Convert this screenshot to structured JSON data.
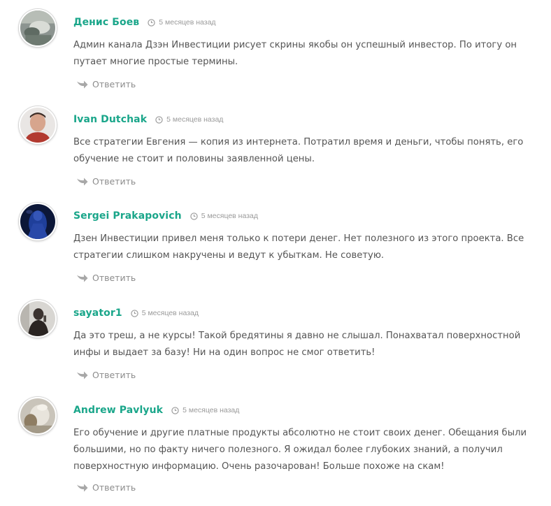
{
  "comments": [
    {
      "author": "Денис Боев",
      "time": "5 месяцев назад",
      "text": "Админ канала Дзэн Инвестиции рисует скрины якобы он успешный инвестор. По итогу он путает многие простые термины.",
      "reply_label": "Ответить",
      "avatar_icon": "user-photo-avatar"
    },
    {
      "author": "Ivan Dutchak",
      "time": "5 месяцев назад",
      "text": "Все стратегии Евгения — копия из интернета. Потратил время и деньги, чтобы понять, его обучение не стоит и половины заявленной цены.",
      "reply_label": "Ответить",
      "avatar_icon": "user-photo-avatar"
    },
    {
      "author": "Sergei Prakapovich",
      "time": "5 месяцев назад",
      "text": "Дзен Инвестиции привел меня только к потери денег. Нет полезного из этого проекта. Все стратегии слишком накручены и ведут к убыткам. Не советую.",
      "reply_label": "Ответить",
      "avatar_icon": "user-photo-avatar"
    },
    {
      "author": "sayator1",
      "time": "5 месяцев назад",
      "text": "Да это треш, а не курсы! Такой бредятины я давно не слышал. Понахватал поверхностной инфы и выдает за базу! Ни на один вопрос не смог ответить!",
      "reply_label": "Ответить",
      "avatar_icon": "user-photo-avatar"
    },
    {
      "author": "Andrew Pavlyuk",
      "time": "5 месяцев назад",
      "text": "Его обучение и другие платные продукты абсолютно не стоит своих денег. Обещания были большими, но по факту ничего полезного. Я ожидал более глубоких знаний, а получил поверхностную информацию. Очень разочарован! Больше похоже на скам!",
      "reply_label": "Ответить",
      "avatar_icon": "user-photo-avatar"
    }
  ],
  "colors": {
    "author": "#1aa68a",
    "text": "#555555",
    "meta": "#9a9a9a",
    "reply": "#8c8c8c"
  },
  "icons": {
    "time": "clock-icon",
    "reply": "reply-arrow-icon"
  }
}
